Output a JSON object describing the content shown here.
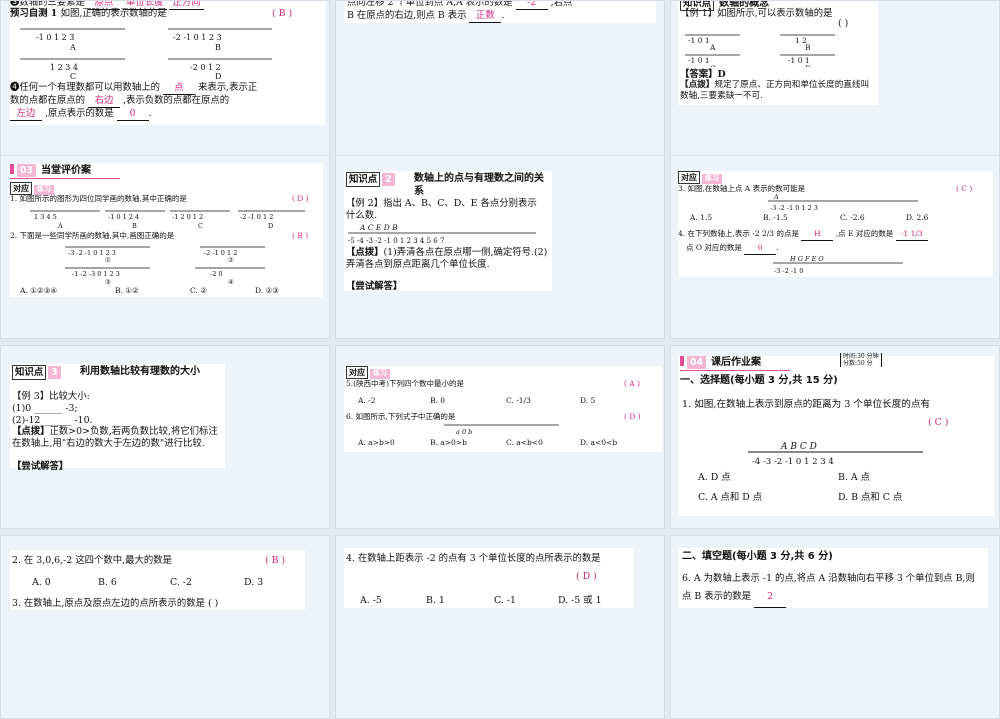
{
  "slides": [
    {
      "top": "❸数轴的三要素是",
      "top_blanks": [
        "原点",
        "单位长度",
        "正方向"
      ],
      "top_ans": "( B )",
      "pretest_label": "预习自测 1",
      "pretest_q": "如图,正确的表示数轴的是",
      "options": [
        "A",
        "B",
        "C",
        "D"
      ],
      "ticks": {
        "A": "-1 0 1 2 3",
        "B": "-2 -1 0 1 2 3",
        "C": "1 2 3 4",
        "D": "-2 0 1 2"
      },
      "q2a": "❹任何一个有理数都可以用数轴上的",
      "q2_blank1": "点",
      "q2b": "来表示,表示正",
      "q2c": "数的点都在原点的",
      "q2_blank2": "右边",
      "q2d": ",表示负数的点都在原点的",
      "q2_blank3": "左边",
      "q2e": ",原点表示的数是",
      "q2_blank4": "0"
    },
    {
      "line1": "点向左移 2 个单位到点 A,A 表示的数是",
      "line1_blank": "-2",
      "line1_end": ",若点",
      "line2": "B 在原点的右边,则点 B 表示",
      "line2_blank": "正数"
    },
    {
      "kp": "知识点",
      "kp_title": "数轴的概念",
      "ex": "【例 1】如图所示,可以表示数轴的是",
      "ex_ans": "(    )",
      "labels": [
        "A",
        "B",
        "C",
        "D"
      ],
      "ans_label": "【答案】D",
      "tip_label": "【点拨】",
      "tip": "规定了原点、正方向和单位长度的直线叫数轴,三要素缺一不可."
    },
    {
      "header": "当堂评价案",
      "header_num": "03",
      "tag": "对应",
      "tag_sub": "练习",
      "q1": "1. 如图所示的图形为四位同学画的数轴,其中正确的是",
      "q1_ans": "( D )",
      "q1_opts": [
        "A",
        "B",
        "C",
        "D"
      ],
      "q2": "2. 下面是一些同学所画的数轴,其中,画图正确的是",
      "q2_ans": "( B )",
      "q2_marks": [
        "①",
        "②",
        "③",
        "④"
      ],
      "q2_opts": [
        "A. ①②③④",
        "B. ①②",
        "C. ②",
        "D. ②③"
      ]
    },
    {
      "kp": "知识点",
      "kp_num": "2",
      "kp_title": "数轴上的点与有理数之间的关系",
      "ex": "【例 2】指出 A、B、C、D、E 各点分别表示什么数.",
      "points": "A  C  E  D  B",
      "ticks": "-5 -4 -3 -2 -1 0 1 2 3 4 5 6 7",
      "tip_label": "【点拨】",
      "tip": "(1)弄清各点在原点哪一侧,确定符号.(2)弄清各点到原点距离几个单位长度.",
      "try": "【尝试解答】"
    },
    {
      "tag": "对应",
      "tag_sub": "练习",
      "q3": "3. 如图,在数轴上点 A 表示的数可能是",
      "q3_ans": "( C )",
      "q3_ticks": "-3 -2 -1 0 1 2 3",
      "q3_opts": [
        "A. 1.5",
        "B. -1.5",
        "C. -2.6",
        "D. 2.6"
      ],
      "q4a": "4. 在下列数轴上,表示 -2 2/3 的点是",
      "q4_blank1": "H",
      "q4b": ",点 E 对应的数是",
      "q4_blank2": "-1 1/3",
      "q4c": "点 O 对应的数是",
      "q4_blank3": "0",
      "q4_points": "H G F E O",
      "q4_ticks": "-3 -2 -1 0"
    },
    {
      "kp": "知识点",
      "kp_num": "3",
      "kp_title": "利用数轴比较有理数的大小",
      "ex": "【例 3】比较大小:",
      "ex1": "(1)0 ______ -3;",
      "ex2": "(2)-12 ______ -10.",
      "tip_label": "【点拨】",
      "tip": "正数>0>负数,若两负数比较,将它们标注在数轴上,用\"右边的数大于左边的数\"进行比较.",
      "try": "【尝试解答】"
    },
    {
      "tag": "对应",
      "tag_sub": "练习",
      "q5": "5.(陕西中考)下列四个数中最小的是",
      "q5_ans": "( A )",
      "q5_opts": [
        "A. -2",
        "B. 0",
        "C. -1/3",
        "D. 5"
      ],
      "q6": "6. 如图所示,下列式子中正确的是",
      "q6_ans": "( D )",
      "q6_line": "a  0  b",
      "q6_opts": [
        "A. a>b>0",
        "B. a>0>b",
        "C. a<b<0",
        "D. a<0<b"
      ]
    },
    {
      "header": "课后作业案",
      "header_num": "04",
      "time": "时间:30 分钟",
      "score": "分数:50 分",
      "sec": "一、选择题(每小题 3 分,共 15 分)",
      "q1": "1. 如图,在数轴上表示到原点的距离为 3 个单位长度的点有",
      "q1_ans": "( C )",
      "points": "A  B  C  D",
      "ticks": "-4 -3 -2 -1 0 1 2 3 4",
      "opts": [
        "A. D 点",
        "B. A 点",
        "C. A 点和 D 点",
        "D. B 点和 C 点"
      ]
    },
    {
      "q2": "2. 在 3,0,6,-2 这四个数中,最大的数是",
      "q2_ans": "( B )",
      "opts": [
        "A. 0",
        "B. 6",
        "C. -2",
        "D. 3"
      ],
      "q3": "3. 在数轴上,原点及原点左边的点所表示的数是 (  )"
    },
    {
      "q4": "4. 在数轴上距表示 -2 的点有 3 个单位长度的点所表示的数是",
      "q4_ans": "( D )",
      "opts": [
        "A. -5",
        "B. 1",
        "C. -1",
        "D. -5 或 1"
      ]
    },
    {
      "sec": "二、填空题(每小题 3 分,共 6 分)",
      "q6": "6. A 为数轴上表示 -1 的点,将点 A 沿数轴向右平移 3 个单位到点 B,则点 B 表示的数是",
      "q6_blank": "2"
    }
  ]
}
